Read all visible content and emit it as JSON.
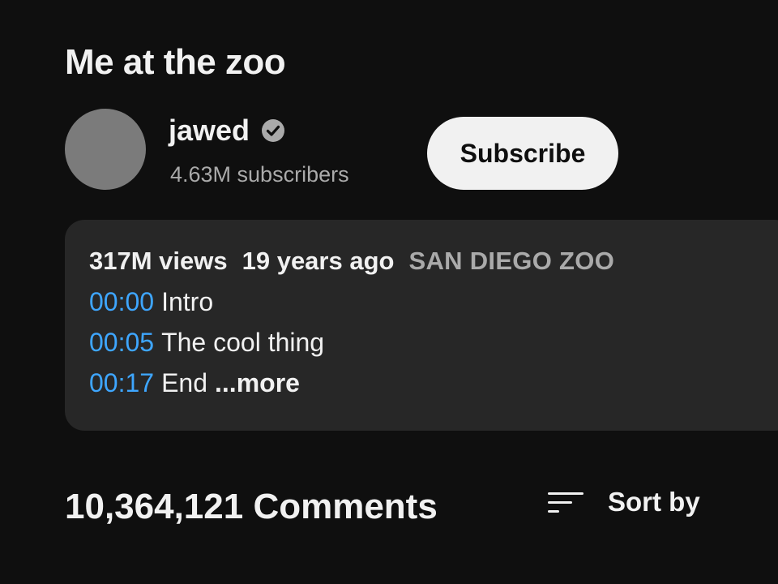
{
  "video": {
    "title": "Me at the zoo"
  },
  "channel": {
    "name": "jawed",
    "verified_icon": "verified-check-icon",
    "subscribers": "4.63M subscribers",
    "subscribe_label": "Subscribe"
  },
  "description": {
    "views": "317M views",
    "age": "19 years ago",
    "location": "SAN DIEGO ZOO",
    "chapters": [
      {
        "time": "00:00",
        "label": "Intro"
      },
      {
        "time": "00:05",
        "label": "The cool thing"
      },
      {
        "time": "00:17",
        "label": "End"
      }
    ],
    "more_label": "...more"
  },
  "comments": {
    "count_label": "10,364,121 Comments",
    "sort_icon": "sort-icon",
    "sort_label": "Sort by"
  },
  "colors": {
    "background": "#0f0f0f",
    "description_bg": "#272727",
    "link_blue": "#3ea6ff",
    "secondary_text": "#aaaaaa",
    "subscribe_bg": "#f1f1f1"
  }
}
